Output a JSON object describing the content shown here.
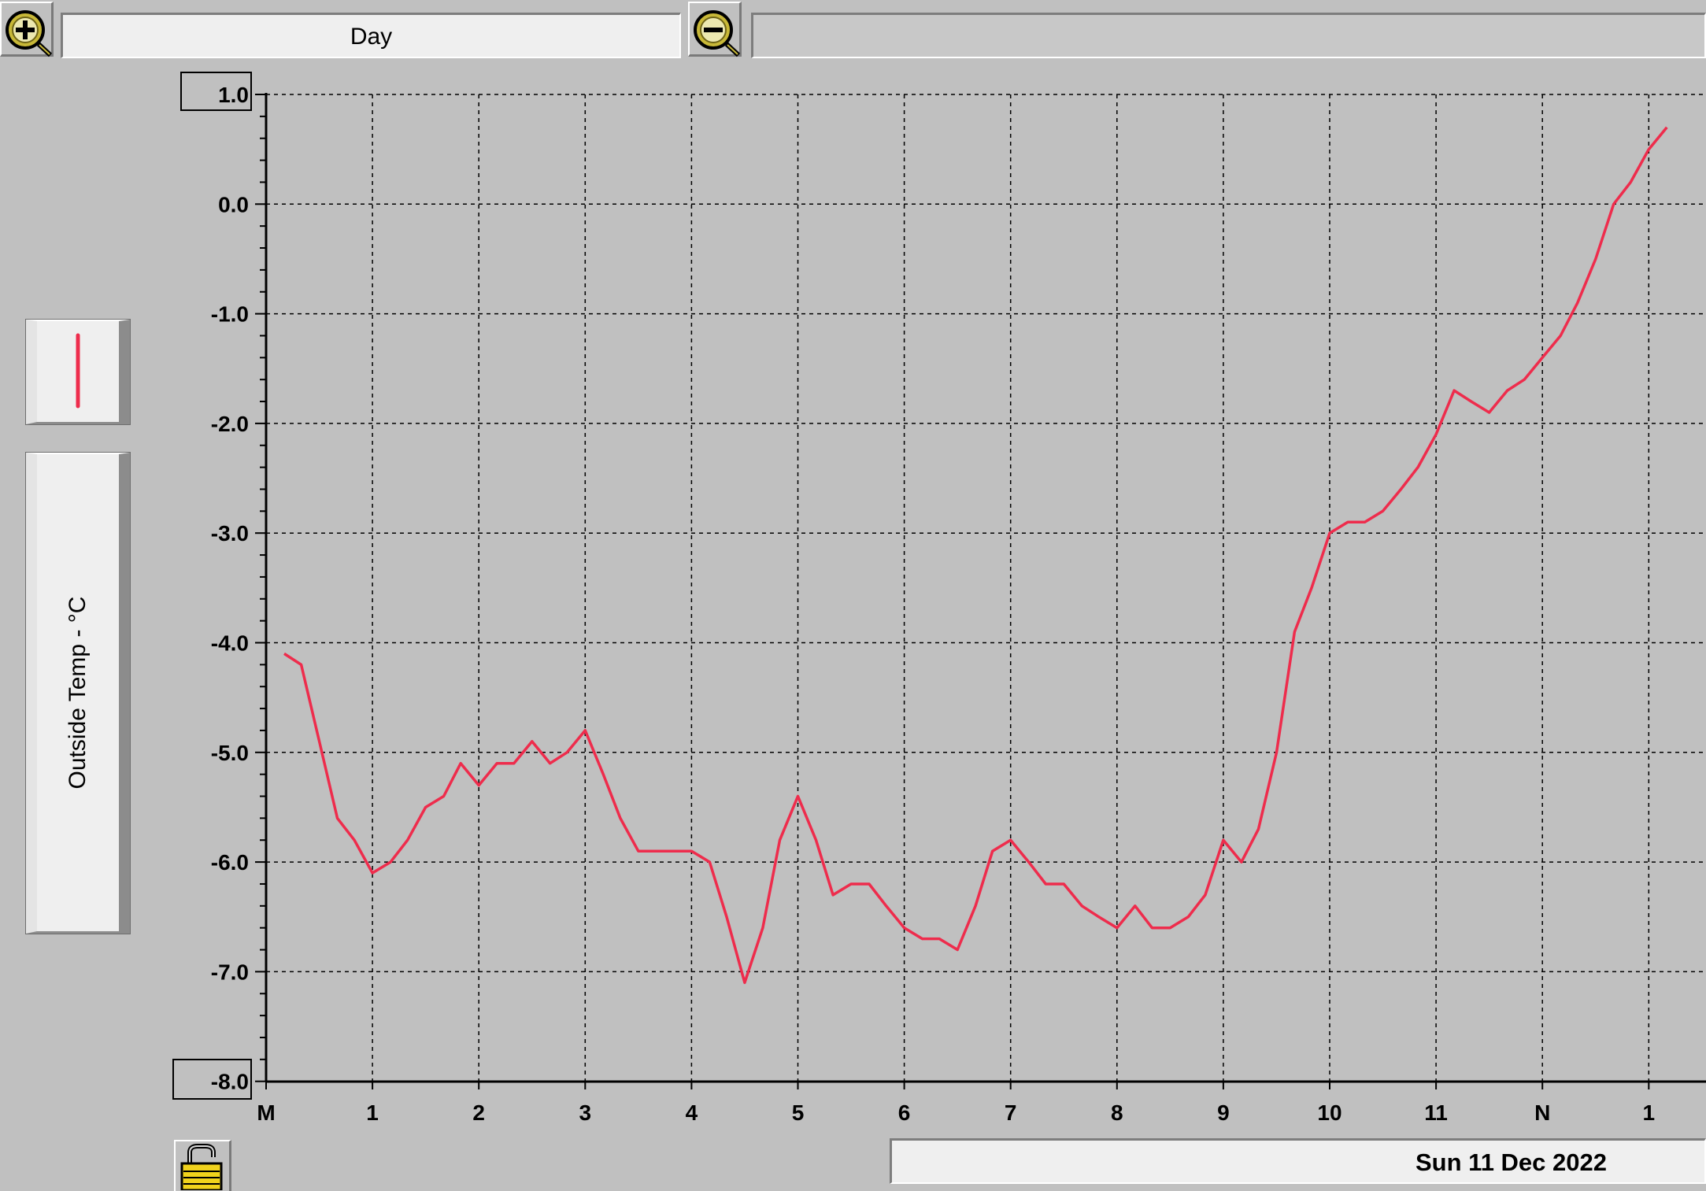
{
  "toolbar": {
    "zoom_in_icon": "zoom-in-icon",
    "zoom_out_icon": "zoom-out-icon",
    "period_label": "Day",
    "range_value": ""
  },
  "legend": {
    "series_label": "Outside Temp - °C",
    "swatch_color": "#ee2c4c"
  },
  "footer": {
    "lock_icon": "unlocked-padlock-icon",
    "date_label": "Sun 11 Dec 2022"
  },
  "chart_data": {
    "type": "line",
    "title": "",
    "xlabel": "",
    "ylabel": "Outside Temp - °C",
    "ylim": [
      -8.0,
      1.0
    ],
    "y_ticks": [
      "1.0",
      "0.0",
      "-1.0",
      "-2.0",
      "-3.0",
      "-4.0",
      "-5.0",
      "-6.0",
      "-7.0",
      "-8.0"
    ],
    "x_tick_labels": [
      "M",
      "1",
      "2",
      "3",
      "4",
      "5",
      "6",
      "7",
      "8",
      "9",
      "10",
      "11",
      "N",
      "1"
    ],
    "x_unit": "hour of day",
    "xlim_hours": [
      0,
      13.5
    ],
    "grid": true,
    "line_color": "#ee2c4c",
    "series": [
      {
        "name": "Outside Temp - °C",
        "x": [
          0.17,
          0.33,
          0.5,
          0.67,
          0.83,
          1.0,
          1.17,
          1.33,
          1.5,
          1.67,
          1.83,
          2.0,
          2.17,
          2.33,
          2.5,
          2.67,
          2.83,
          3.0,
          3.17,
          3.33,
          3.5,
          3.67,
          3.83,
          4.0,
          4.17,
          4.33,
          4.5,
          4.67,
          4.83,
          5.0,
          5.17,
          5.33,
          5.5,
          5.67,
          5.83,
          6.0,
          6.17,
          6.33,
          6.5,
          6.67,
          6.83,
          7.0,
          7.17,
          7.33,
          7.5,
          7.67,
          7.83,
          8.0,
          8.17,
          8.33,
          8.5,
          8.67,
          8.83,
          9.0,
          9.17,
          9.33,
          9.5,
          9.67,
          9.83,
          10.0,
          10.17,
          10.33,
          10.5,
          10.67,
          10.83,
          11.0,
          11.17,
          11.33,
          11.5,
          11.67,
          11.83,
          12.0,
          12.17,
          12.33,
          12.5,
          12.67,
          12.83,
          13.0,
          13.17
        ],
        "y": [
          -4.1,
          -4.2,
          -4.9,
          -5.6,
          -5.8,
          -6.1,
          -6.0,
          -5.8,
          -5.5,
          -5.4,
          -5.1,
          -5.3,
          -5.1,
          -5.1,
          -4.9,
          -5.1,
          -5.0,
          -4.8,
          -5.2,
          -5.6,
          -5.9,
          -5.9,
          -5.9,
          -5.9,
          -6.0,
          -6.5,
          -7.1,
          -6.6,
          -5.8,
          -5.4,
          -5.8,
          -6.3,
          -6.2,
          -6.2,
          -6.4,
          -6.6,
          -6.7,
          -6.7,
          -6.8,
          -6.4,
          -5.9,
          -5.8,
          -6.0,
          -6.2,
          -6.2,
          -6.4,
          -6.5,
          -6.6,
          -6.4,
          -6.6,
          -6.6,
          -6.5,
          -6.3,
          -5.8,
          -6.0,
          -5.7,
          -5.0,
          -3.9,
          -3.5,
          -3.0,
          -2.9,
          -2.9,
          -2.8,
          -2.6,
          -2.4,
          -2.1,
          -1.7,
          -1.8,
          -1.9,
          -1.7,
          -1.6,
          -1.4,
          -1.2,
          -0.9,
          -0.5,
          0.0,
          0.2,
          0.5,
          0.7
        ]
      }
    ]
  }
}
